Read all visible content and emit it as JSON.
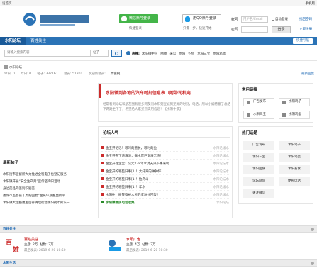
{
  "topbar": {
    "home": "设首页",
    "right": "手机版"
  },
  "login": {
    "wechat_label": "微信账号登录",
    "wechat_sub": "快捷登录",
    "qq_label": "用QQ账号登录",
    "qq_sub": "只需一步，快速开始",
    "account_label": "帐号",
    "account_placeholder": "用户名/Email",
    "auto_login": "自动登录",
    "find_password": "找回密码",
    "password_label": "密码",
    "login_button": "登录",
    "register": "立即注册"
  },
  "nav": {
    "tabs": [
      "水阳论坛",
      "百姓关注"
    ],
    "quick": "快捷导航"
  },
  "search": {
    "placeholder": "请输入搜索内容",
    "scope": "帖子",
    "hot_label": "热搜:",
    "hot_words": [
      "水阳镇中学",
      "圈圈",
      "采公",
      "水阳",
      "钓鱼",
      "水阳三宝",
      "水阳鸡蛋"
    ]
  },
  "breadcrumb": "水阳论坛",
  "stats": {
    "today": "今日: 0",
    "yesterday": "昨日: 0",
    "posts": "帖子: 337161",
    "members": "会员: 51801",
    "welcome": "欢迎新会员:",
    "new_member": "周俊锐"
  },
  "latest_reply": "最新回复",
  "headline": {
    "title": "水阳镇到各地的汽车时刻信息表（附带司机电",
    "desc": "经常看到论坛和朋友圈有很多网友问水阳到宣城到芜湖的时刻，电话，所以小编特意了总结下两路坐下了，希望给大家买点实用信息！【水阳十景】"
  },
  "popular": {
    "title": "论坛人气",
    "rows": [
      {
        "t": "金宝开记忆！哪时的道长，哪时的鱼",
        "src": "水阳论坛水"
      },
      {
        "t": "金宝开布下道海湾，瘤水岸巨宽海无声！",
        "src": "水阳论坛水"
      },
      {
        "t": "金宝开雄宝宝！公元238年水莫夫兴下事来明",
        "src": "水阳论坛水"
      },
      {
        "t": "金宝开的哪些旧事[1]！大托海的钟钟怀",
        "src": "水阳论坛水"
      },
      {
        "t": "金宝开的哪些旧事[1]！拉鸟斗",
        "src": "水阳论坛水"
      },
      {
        "t": "金宝开的哪些旧事[1]！年水",
        "src": "水阳论坛水"
      },
      {
        "t": "水阳往！搬警察被人民的老坊好回复！",
        "src": "水阳论坛水"
      },
      {
        "t": "水阳镇便民电话收集",
        "src": "水阳论坛"
      }
    ]
  },
  "latest_posts": {
    "title": "最新帖子",
    "items": [
      "水阳街市监督所大力推进全程电子化登记服务—",
      "水阳镇开展“安全生产月”宣传咨询日活动",
      "身边药品的鉴别识别鉴",
      "墨城市监督县丁周购回复“金属环期整血所带",
      "水阳镇大理整更生后存清理检督水阳街市所东一"
    ]
  },
  "common": {
    "title": "常用链接",
    "buttons": [
      "广告发布",
      "水阳鸡子",
      "水阳三宝",
      "水阳鸡蛋"
    ]
  },
  "hot": {
    "title": "热门话题",
    "buttons": [
      "广告发布",
      "水阳鸡子",
      "水阳三宝",
      "水阳鸡蛋",
      "水阳面食",
      "水阳畜食",
      "论坛网址",
      "便民电话",
      "关注微信",
      ""
    ]
  },
  "sections": {
    "focus": "百姓关注",
    "life": "水阳生活"
  },
  "sub_forums": [
    {
      "name": "百姓关注",
      "meta": "主题: 2万,  帖数: 3万",
      "last": "最后发表: 2019-6-20 10:50"
    },
    {
      "name": "水阳广告",
      "meta": "主题: 4万,  帖数: 3万",
      "last": "最后发表: 2019-6-20 10:30"
    }
  ]
}
